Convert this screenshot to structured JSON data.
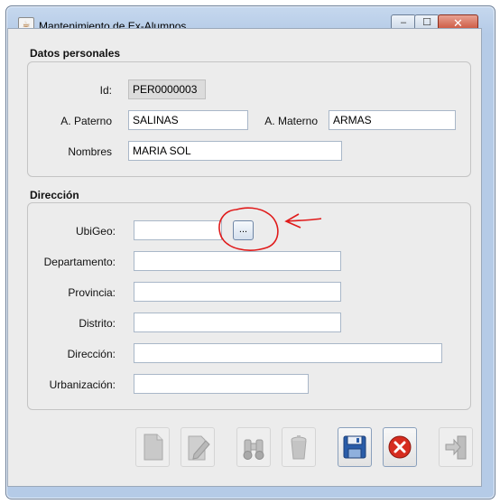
{
  "window": {
    "title": "Mantenimiento de Ex-Alumnos",
    "app_icon": "java-cup-icon",
    "minimize_glyph": "–",
    "maximize_glyph": "☐",
    "close_glyph": "✕"
  },
  "personal": {
    "title": "Datos personales",
    "id_label": "Id:",
    "id_value": "PER0000003",
    "paterno_label": "A. Paterno",
    "paterno_value": "SALINAS",
    "materno_label": "A. Materno",
    "materno_value": "ARMAS",
    "nombres_label": "Nombres",
    "nombres_value": "MARIA SOL"
  },
  "address": {
    "title": "Dirección",
    "ubigeo_label": "UbiGeo:",
    "ubigeo_value": "",
    "ubigeo_button": "...",
    "departamento_label": "Departamento:",
    "departamento_value": "",
    "provincia_label": "Provincia:",
    "provincia_value": "",
    "distrito_label": "Distrito:",
    "distrito_value": "",
    "direccion_label": "Dirección:",
    "direccion_value": "",
    "urbanizacion_label": "Urbanización:",
    "urbanizacion_value": ""
  },
  "toolbar": {
    "buttons": [
      {
        "name": "new-document-icon",
        "enabled": false
      },
      {
        "name": "edit-pencil-icon",
        "enabled": false
      },
      {
        "name": "binoculars-search-icon",
        "enabled": false
      },
      {
        "name": "trash-can-icon",
        "enabled": false
      },
      {
        "name": "save-floppy-icon",
        "enabled": true
      },
      {
        "name": "cancel-x-icon",
        "enabled": true
      },
      {
        "name": "exit-door-icon",
        "enabled": false
      }
    ]
  },
  "colors": {
    "annotation_red": "#e01a1a",
    "cancel_red": "#d62c1f",
    "save_blue": "#2a5ca8"
  }
}
